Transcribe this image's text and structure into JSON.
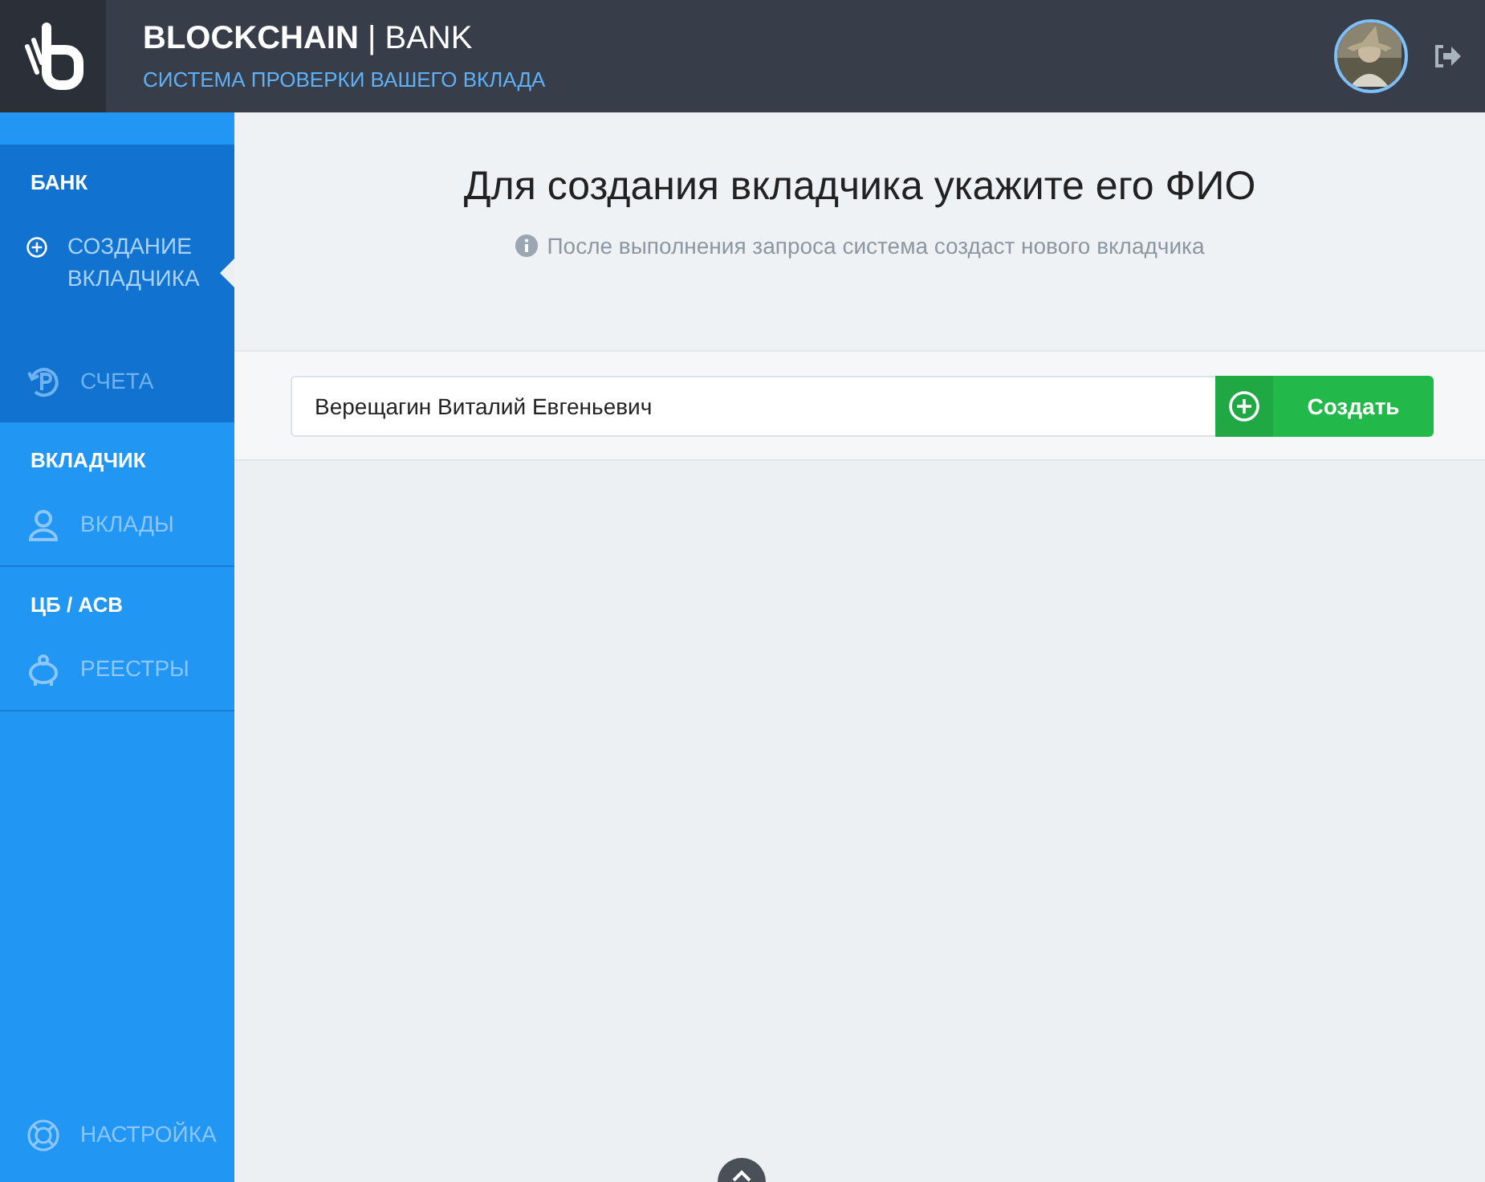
{
  "header": {
    "brand_bold": "BLOCKCHAIN",
    "brand_separator": "|",
    "brand_rest": "BANK",
    "subtitle": "СИСТЕМА ПРОВЕРКИ ВАШЕГО ВКЛАДА"
  },
  "sidebar": {
    "sections": [
      {
        "title": "БАНК",
        "active": true,
        "items": [
          {
            "label": "СОЗДАНИЕ ВКЛАДЧИКА",
            "selected": true
          },
          {
            "label": "СЧЕТА",
            "selected": false
          }
        ]
      },
      {
        "title": "ВКЛАДЧИК",
        "active": false,
        "items": [
          {
            "label": "ВКЛАДЫ",
            "selected": false
          }
        ]
      },
      {
        "title": "ЦБ / АСВ",
        "active": false,
        "items": [
          {
            "label": "РЕЕСТРЫ",
            "selected": false
          }
        ]
      }
    ],
    "footer_item": {
      "label": "НАСТРОЙКА",
      "selected": false
    }
  },
  "main": {
    "heading": "Для создания вкладчика укажите его ФИО",
    "hint": "После выполнения запроса система создаст нового вкладчика",
    "form": {
      "name_value": "Верещагин Виталий Евгеньевич",
      "submit_label": "Создать"
    }
  }
}
